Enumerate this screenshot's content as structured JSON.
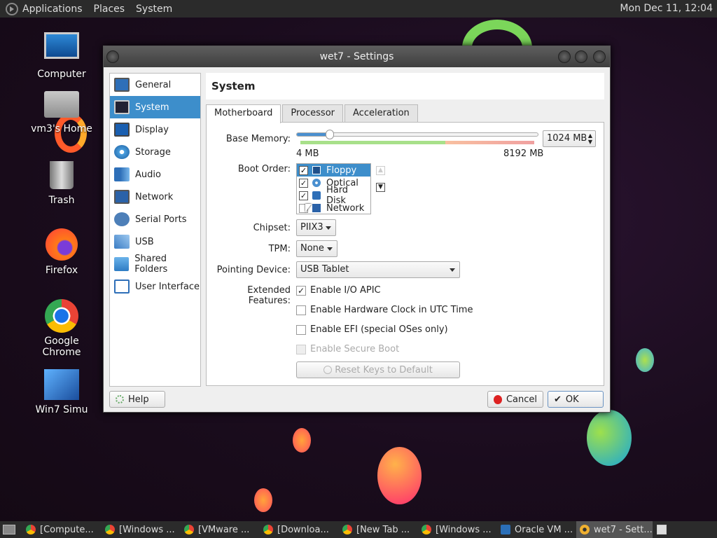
{
  "topbar": {
    "menus": [
      "Applications",
      "Places",
      "System"
    ],
    "clock": "Mon Dec 11, 12:04"
  },
  "desktop": {
    "icons": [
      "Computer",
      "vm3's Home",
      "Trash",
      "Firefox",
      "Google Chrome",
      "Win7 Simu"
    ]
  },
  "window": {
    "title": "wet7 - Settings"
  },
  "sidebar": {
    "items": [
      "General",
      "System",
      "Display",
      "Storage",
      "Audio",
      "Network",
      "Serial Ports",
      "USB",
      "Shared Folders",
      "User Interface"
    ],
    "active": "System"
  },
  "section": {
    "title": "System"
  },
  "tabs": [
    "Motherboard",
    "Processor",
    "Acceleration"
  ],
  "motherboard": {
    "base_memory": {
      "label": "Base Memory:",
      "value_mb": 1024,
      "min_mb": 4,
      "max_mb": 8192,
      "field": "1024 MB",
      "min_label": "4 MB",
      "max_label": "8192 MB"
    },
    "boot_order": {
      "label": "Boot Order:",
      "items": [
        {
          "name": "Floppy",
          "checked": true
        },
        {
          "name": "Optical",
          "checked": true
        },
        {
          "name": "Hard Disk",
          "checked": true
        },
        {
          "name": "Network",
          "checked": false
        }
      ]
    },
    "chipset": {
      "label": "Chipset:",
      "value": "PIIX3"
    },
    "tpm": {
      "label": "TPM:",
      "value": "None"
    },
    "pointing": {
      "label": "Pointing Device:",
      "value": "USB Tablet"
    },
    "extended": {
      "label": "Extended Features:",
      "options": [
        "Enable I/O APIC",
        "Enable Hardware Clock in UTC Time",
        "Enable EFI (special OSes only)",
        "Enable Secure Boot"
      ],
      "checked": [
        true,
        false,
        false,
        false
      ]
    },
    "reset_keys": "Reset Keys to Default"
  },
  "footer": {
    "help": "Help",
    "cancel": "Cancel",
    "ok": "OK"
  },
  "taskbar": {
    "tasks": [
      "[Compute...",
      "[Windows ...",
      "[VMware ...",
      "[Downloa...",
      "[New Tab ...",
      "[Windows ...",
      "Oracle VM ...",
      "wet7 - Sett..."
    ]
  },
  "colors": {
    "accent": "#3d8ecb",
    "titlebar": "#4a4a4a"
  }
}
